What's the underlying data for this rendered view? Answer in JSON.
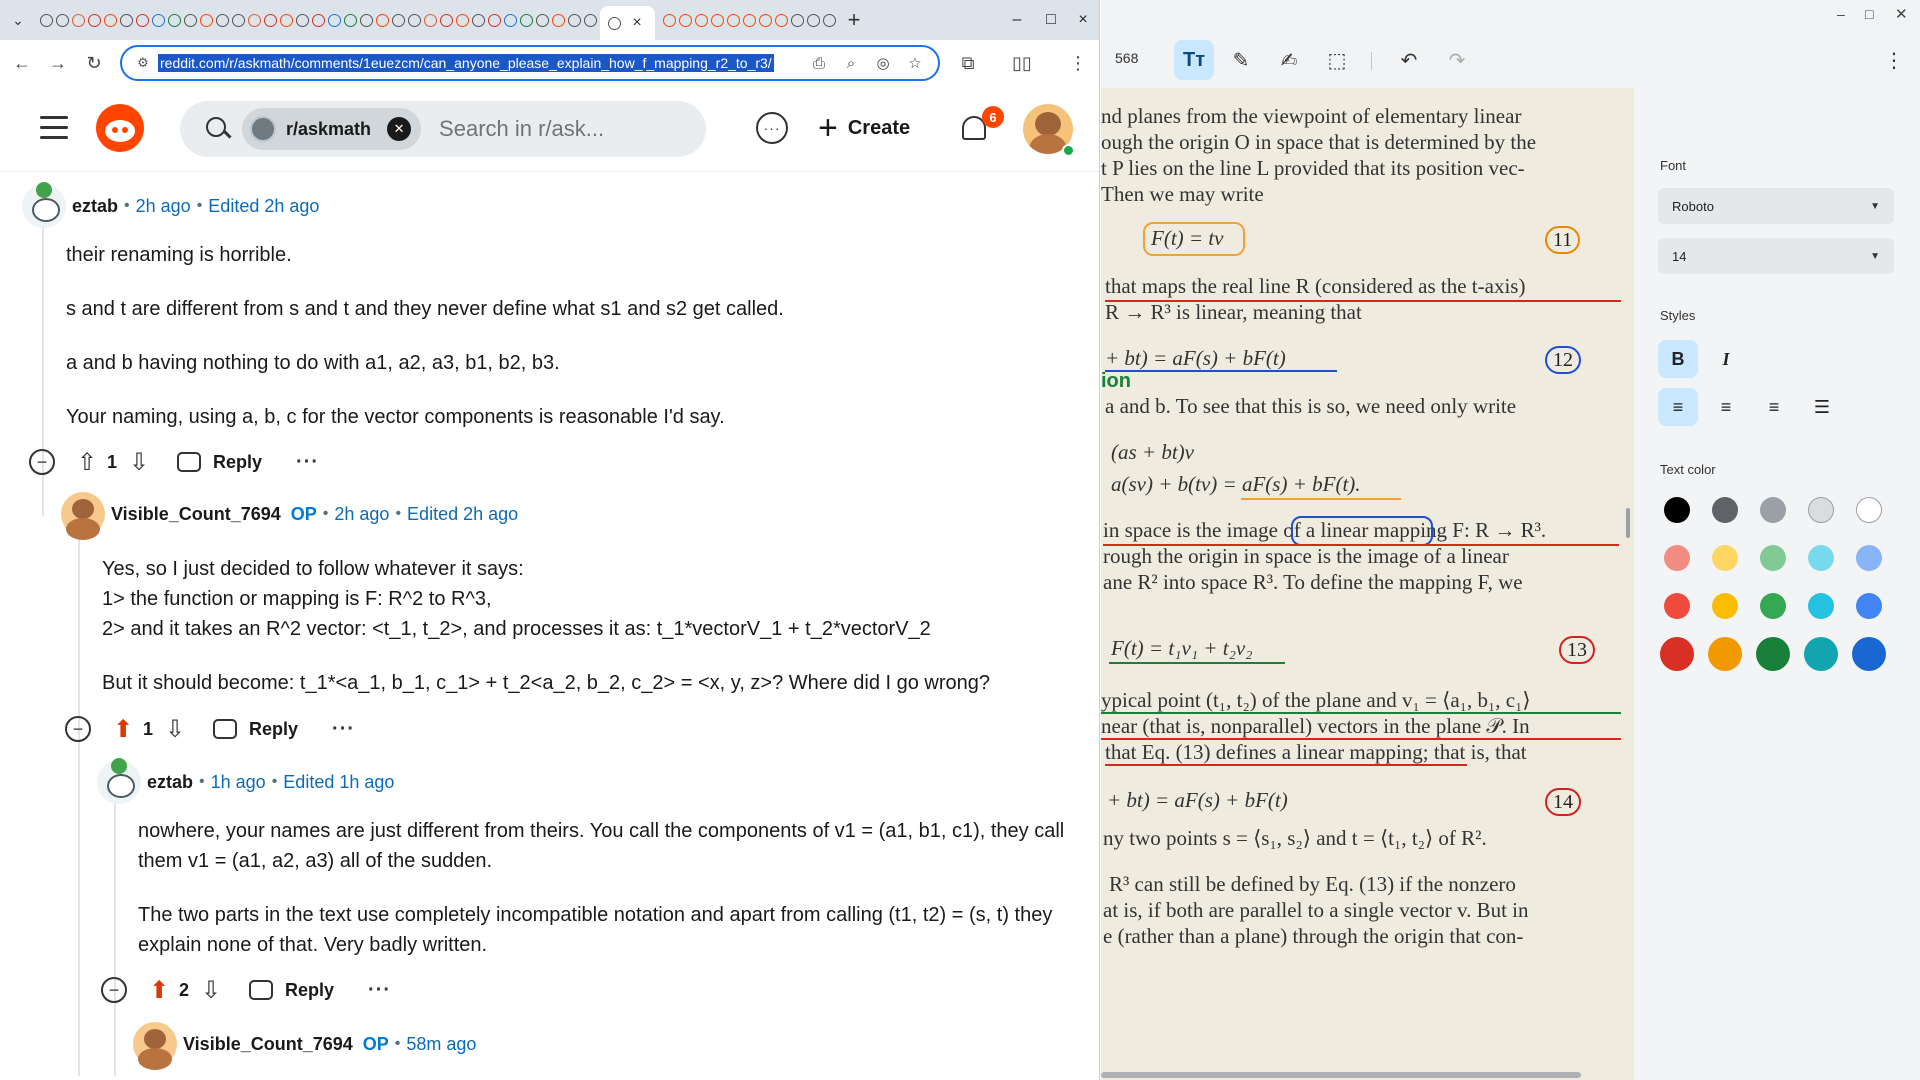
{
  "browser": {
    "active_tab_close": "×",
    "new_tab": "+",
    "url": "reddit.com/r/askmath/comments/1euezcm/can_anyone_please_explain_how_f_mapping_r2_to_r3/",
    "window_controls": [
      "–",
      "□",
      "×"
    ]
  },
  "reddit": {
    "subreddit": "r/askmath",
    "search_placeholder": "Search in r/ask...",
    "create_label": "Create",
    "notification_count": "6"
  },
  "comments": [
    {
      "author": "eztab",
      "op": "",
      "time": "2h ago",
      "edited": "Edited 2h ago",
      "paragraphs": [
        "their renaming is horrible.",
        "s and t are different from s and t and they never define what s1 and s2 get called.",
        "a and b having nothing to do with a1, a2, a3, b1, b2, b3.",
        "Your naming, using a, b, c for the vector components is reasonable I'd say."
      ],
      "votes": "1",
      "upvoted": false,
      "reply_label": "Reply",
      "more_label": "···"
    },
    {
      "author": "Visible_Count_7694",
      "op": "OP",
      "time": "2h ago",
      "edited": "Edited 2h ago",
      "paragraphs": [
        "Yes, so I just decided to follow whatever it says:",
        "1> the function or mapping is F: R^2 to R^3,",
        "2> and it takes an R^2 vector: <t_1, t_2>, and processes it as: t_1*vectorV_1 + t_2*vectorV_2",
        "But it should become: t_1*<a_1, b_1, c_1> + t_2<a_2, b_2, c_2> = <x, y, z>? Where did I go wrong?"
      ],
      "votes": "1",
      "upvoted": true,
      "reply_label": "Reply",
      "more_label": "···"
    },
    {
      "author": "eztab",
      "op": "",
      "time": "1h ago",
      "edited": "Edited 1h ago",
      "paragraphs": [
        "nowhere, your names are just different from theirs. You call the components of v1 = (a1, b1, c1), they call them v1 = (a1, a2, a3) all of the sudden.",
        "The two parts in the text use completely incompatible notation and apart from calling (t1, t2) = (s, t) they explain none of that. Very badly written."
      ],
      "votes": "2",
      "upvoted": true,
      "reply_label": "Reply",
      "more_label": "···"
    },
    {
      "author": "Visible_Count_7694",
      "op": "OP",
      "time": "58m ago",
      "edited": ""
    }
  ],
  "pdf": {
    "page_number": "568",
    "lines": [
      "nd planes from the viewpoint of elementary linear",
      "ough the origin O in space that is determined by the",
      "t P lies on the line L provided that its position vec-",
      "Then we may write",
      "F(t) = tv",
      "that maps the real line R (considered as the t-axis)",
      "R → R³ is linear, meaning that",
      "+ bt) = aF(s) + bF(t)",
      "ion",
      "a and b. To see that this is so, we need only write",
      "(as + bt)v",
      "a(sv) + b(tv) = aF(s) + bF(t).",
      "in space is the image of a linear mapping F: R → R³.",
      "rough the origin in space is the image of a linear",
      "ane R² into space R³. To define the mapping F, we",
      "F(t) = t₁v₁ + t₂v₂",
      "ypical point (t₁, t₂) of the plane and v₁ = ⟨a₁, b₁, c₁⟩",
      "near (that is, nonparallel) vectors in the plane 𝒫. In",
      "that Eq. (13) defines a linear mapping; that is, that",
      "+ bt) = aF(s) + bF(t)",
      "ny two points s = ⟨s₁, s₂⟩ and t = ⟨t₁, t₂⟩ of R².",
      "R³ can still be defined by Eq. (13) if the nonzero",
      "at is, if both are parallel to a single vector v. But in",
      "e (rather than a plane) through the origin that con-"
    ],
    "eq_numbers": [
      "11",
      "12",
      "13",
      "14"
    ],
    "panel": {
      "font_label": "Font",
      "font_value": "Roboto",
      "size_value": "14",
      "styles_label": "Styles",
      "bold_label": "B",
      "italic_label": "I",
      "text_color_label": "Text color",
      "colors": [
        "#000000",
        "#5f6368",
        "#9aa0a6",
        "#dadce0",
        "#ffffff",
        "#f28b82",
        "#fdd663",
        "#81c995",
        "#78d9ec",
        "#8ab4f8",
        "#ee4b3e",
        "#fbbc04",
        "#34a853",
        "#24c1e0",
        "#4285f4",
        "#d93025",
        "#f29900",
        "#188038",
        "#12a4af",
        "#1967d2"
      ]
    }
  },
  "colors": {
    "reddit_orange": "#ff4500",
    "link_blue": "#0b6bb8",
    "op_blue": "#0079d3",
    "upvote_active": "#d93a00",
    "selection_blue": "#c9e7ff"
  }
}
